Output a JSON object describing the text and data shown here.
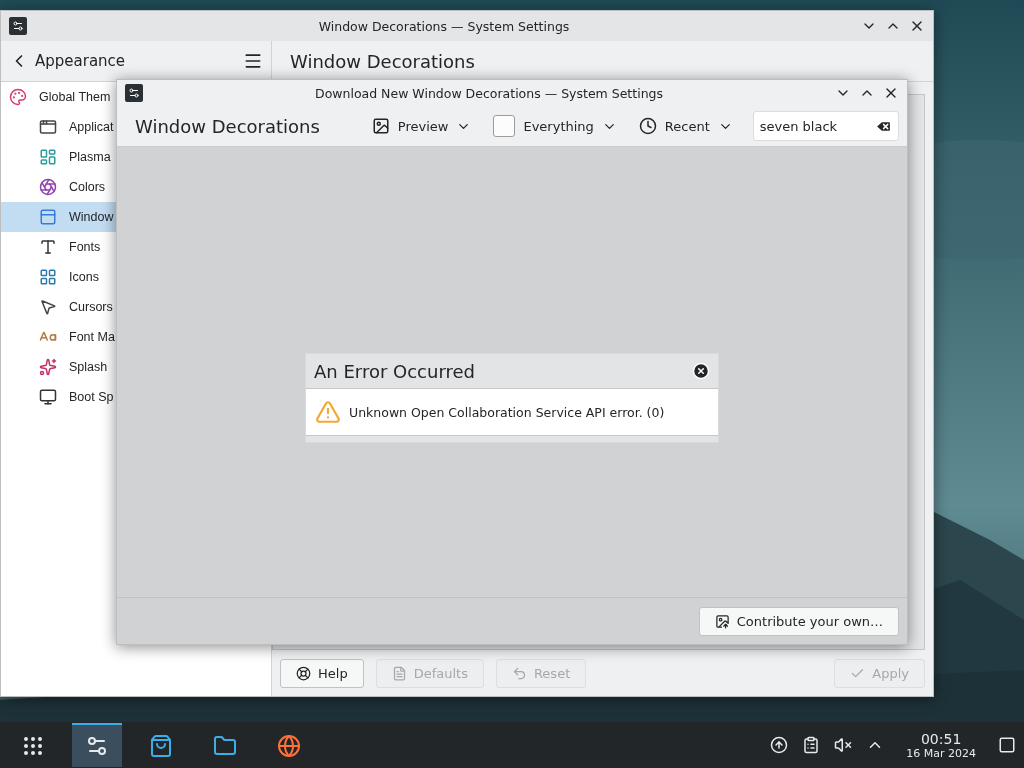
{
  "settings_window": {
    "title": "Window Decorations — System Settings",
    "sidebar": {
      "back_label": "Appearance",
      "items": [
        {
          "kind": "theme",
          "label": "Global Them",
          "selected": false,
          "children": [
            {
              "kind": "style",
              "label": "Applicat",
              "selected": false
            },
            {
              "kind": "plasma",
              "label": "Plasma",
              "selected": false
            },
            {
              "kind": "colors",
              "label": "Colors",
              "selected": false
            },
            {
              "kind": "window",
              "label": "Window",
              "selected": true
            },
            {
              "kind": "fonts",
              "label": "Fonts",
              "selected": false
            },
            {
              "kind": "icons",
              "label": "Icons",
              "selected": false
            },
            {
              "kind": "cursors",
              "label": "Cursors",
              "selected": false
            },
            {
              "kind": "fontmgmt",
              "label": "Font Ma",
              "selected": false
            },
            {
              "kind": "splash",
              "label": "Splash",
              "selected": false
            },
            {
              "kind": "boot",
              "label": "Boot Sp",
              "selected": false
            }
          ]
        }
      ]
    },
    "heading": "Window Decorations",
    "buttons": [
      {
        "kind": "help",
        "label": "Help",
        "disabled": false
      },
      {
        "kind": "defaults",
        "label": "Defaults",
        "disabled": true
      },
      {
        "kind": "reset",
        "label": "Reset",
        "disabled": true
      },
      {
        "kind": "apply",
        "label": "Apply",
        "disabled": true
      }
    ]
  },
  "dialog": {
    "title": "Download New Window Decorations — System Settings",
    "heading": "Window Decorations",
    "filters": [
      {
        "kind": "preview",
        "label": "Preview"
      },
      {
        "kind": "checkbox",
        "label": "Everything"
      },
      {
        "kind": "clock",
        "label": "Recent"
      }
    ],
    "search": {
      "value": "seven black"
    },
    "error": {
      "title": "An Error Occurred",
      "message": "Unknown Open Collaboration Service API error. (0)"
    },
    "contribute_button": "Contribute your own…"
  },
  "taskbar": {
    "apps": [
      {
        "kind": "launcher",
        "selected": false
      },
      {
        "kind": "settings",
        "selected": true
      },
      {
        "kind": "store",
        "selected": false
      },
      {
        "kind": "files",
        "selected": false
      },
      {
        "kind": "browser",
        "selected": false
      }
    ],
    "tray": [
      {
        "kind": "updates"
      },
      {
        "kind": "clipboard"
      },
      {
        "kind": "volume-muted"
      },
      {
        "kind": "expand"
      }
    ],
    "clock": {
      "time": "00:51",
      "date": "16 Mar 2024"
    }
  }
}
